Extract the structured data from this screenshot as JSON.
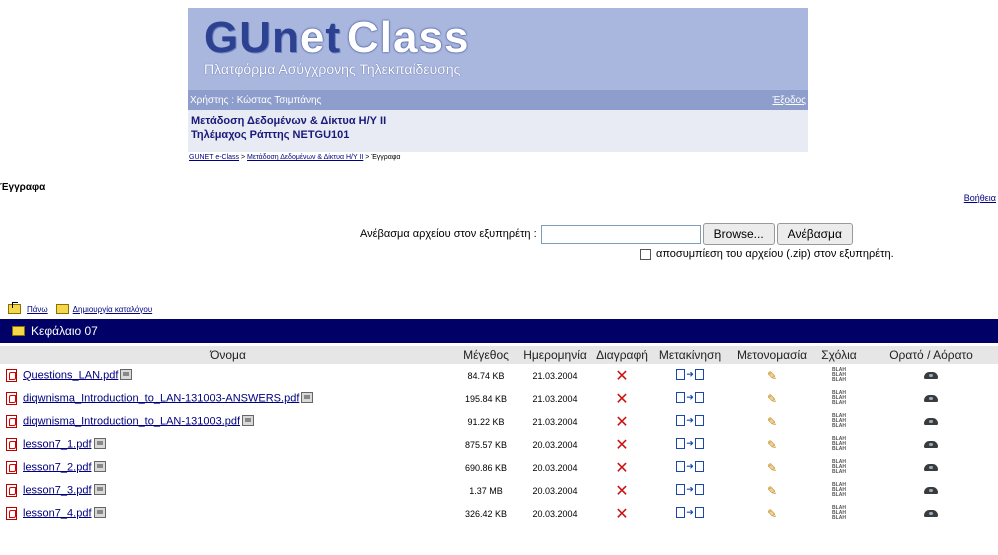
{
  "header": {
    "logo_gu": "GUn",
    "logo_e": "e",
    "logo_t": "t",
    "logo_class": "Class",
    "tagline": "Πλατφόρμα Ασύγχρονης Τηλεκπαίδευσης",
    "user_label": "Χρήστης : Κώστας Τσιμπάνης",
    "logout": "Έξοδος",
    "course_title": "Μετάδοση Δεδομένων & Δίκτυα Η/Υ ΙΙ",
    "course_instructor": "Τηλέμαχος Ράπτης NETGU101"
  },
  "breadcrumb": {
    "home": "GUNET e-Class",
    "course": "Μετάδοση Δεδομένων & Δίκτυα Η/Υ ΙΙ",
    "sep": " > ",
    "current": "Έγγραφα"
  },
  "page": {
    "title": "Έγγραφα",
    "help": "Βοήθεια"
  },
  "upload": {
    "label": "Ανέβασμα αρχείου στον εξυπηρέτη :",
    "browse": "Browse...",
    "submit": "Ανέβασμα",
    "unzip_label": "αποσυμπίεση του αρχείου (.zip) στον εξυπηρέτη."
  },
  "toolbar": {
    "up": "Πάνω",
    "create_dir": "Δημιουργία καταλόγου"
  },
  "folder": {
    "name": "Κεφάλαιο 07"
  },
  "table": {
    "headers": [
      "Όνομα",
      "Μέγεθος",
      "Ημερομηνία",
      "Διαγραφή",
      "Μετακίνηση",
      "Μετονομασία",
      "Σχόλια",
      "Ορατό / Αόρατο"
    ],
    "rows": [
      {
        "name": "Questions_LAN.pdf",
        "size": "84.74 KB",
        "date": "21.03.2004"
      },
      {
        "name": "diqwnisma_Introduction_to_LAN-131003-ANSWERS.pdf",
        "size": "195.84 KB",
        "date": "21.03.2004"
      },
      {
        "name": "diqwnisma_Introduction_to_LAN-131003.pdf",
        "size": "91.22 KB",
        "date": "21.03.2004"
      },
      {
        "name": "lesson7_1.pdf",
        "size": "875.57 KB",
        "date": "20.03.2004"
      },
      {
        "name": "lesson7_2.pdf",
        "size": "690.86 KB",
        "date": "20.03.2004"
      },
      {
        "name": "lesson7_3.pdf",
        "size": "1.37 MB",
        "date": "20.03.2004"
      },
      {
        "name": "lesson7_4.pdf",
        "size": "326.42 KB",
        "date": "20.03.2004"
      }
    ],
    "blah_text": "BLAH"
  },
  "colors": {
    "banner": "#a9b6dd",
    "userbar": "#8e9ecc",
    "folder_bar": "#000066",
    "delete": "#cc1111"
  }
}
